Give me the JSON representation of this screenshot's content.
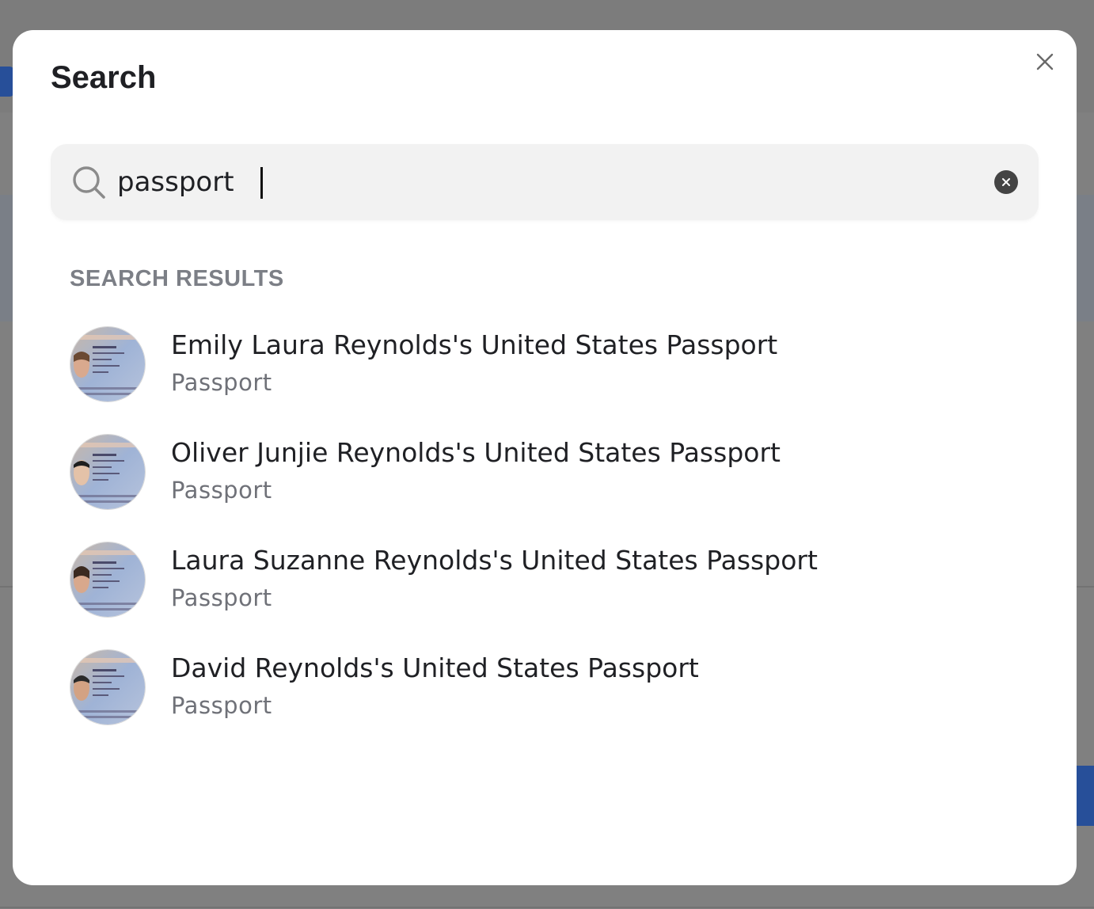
{
  "modal": {
    "title": "Search"
  },
  "search": {
    "value": "passport",
    "placeholder": ""
  },
  "results": {
    "label": "SEARCH RESULTS",
    "items": [
      {
        "title": "Emily Laura Reynolds's United States Passport",
        "subtitle": "Passport"
      },
      {
        "title": "Oliver Junjie Reynolds's United States Passport",
        "subtitle": "Passport"
      },
      {
        "title": "Laura Suzanne Reynolds's United States Passport",
        "subtitle": "Passport"
      },
      {
        "title": "David Reynolds's United States Passport",
        "subtitle": "Passport"
      }
    ]
  },
  "colors": {
    "overlay": "#808080",
    "modal_bg": "#ffffff",
    "search_bg": "#f2f2f2",
    "accent_blue": "#274f99",
    "text_primary": "#1f2024",
    "text_secondary": "#6f7178"
  },
  "icons": {
    "close": "close-icon",
    "search": "search-icon",
    "clear": "clear-icon"
  }
}
